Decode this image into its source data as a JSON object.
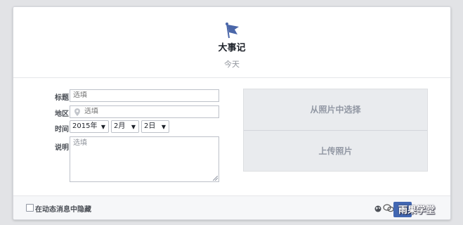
{
  "header": {
    "icon": "flag-icon",
    "title": "大事记",
    "subtitle": "今天"
  },
  "form": {
    "title_label": "标题",
    "title_placeholder": "选填",
    "location_label": "地区",
    "location_placeholder": "选填",
    "location_icon": "map-pin-icon",
    "time_label": "时间",
    "year_value": "2015年",
    "month_value": "2月",
    "day_value": "2日",
    "description_label": "说明",
    "description_placeholder": "选填"
  },
  "photos": {
    "choose_label": "从照片中选择",
    "upload_label": "上传照片"
  },
  "footer": {
    "hide_label": "在动态消息中隐藏",
    "privacy_icon": "globe-icon",
    "watermark_text": "雨果学堂"
  },
  "colors": {
    "accent": "#4267b2",
    "photo_text": "#9197a3"
  }
}
